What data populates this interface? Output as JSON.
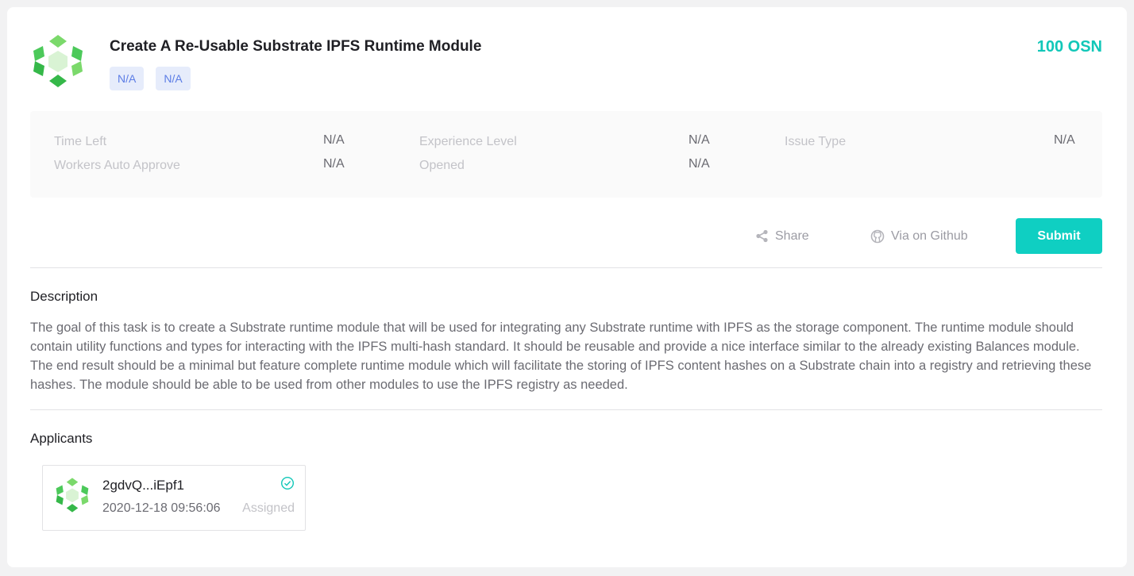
{
  "task": {
    "title": "Create A Re-Usable Substrate IPFS Runtime Module",
    "tags": [
      "N/A",
      "N/A"
    ],
    "reward": "100 OSN"
  },
  "info": {
    "time_left_label": "Time Left",
    "time_left_value": "N/A",
    "workers_auto_approve_label": "Workers Auto Approve",
    "workers_auto_approve_value": "N/A",
    "experience_level_label": "Experience Level",
    "experience_level_value": "N/A",
    "opened_label": "Opened",
    "opened_value": "N/A",
    "issue_type_label": "Issue Type",
    "issue_type_value": "N/A"
  },
  "actions": {
    "share_label": "Share",
    "github_label": "Via on Github",
    "submit_label": "Submit"
  },
  "description": {
    "heading": "Description",
    "text": "The goal of this task is to create a Substrate runtime module that will be used for integrating any Substrate runtime with IPFS as the storage component. The runtime module should contain utility functions and types for interacting with the IPFS multi-hash standard. It should be reusable and provide a nice interface similar to the already existing Balances module. The end result should be a minimal but feature complete runtime module which will facilitate the storing of IPFS content hashes on a Substrate chain into a registry and retrieving these hashes. The module should be able to be used from other modules to use the IPFS registry as needed."
  },
  "applicants": {
    "heading": "Applicants",
    "items": [
      {
        "name": "2gdvQ...iEpf1",
        "time": "2020-12-18 09:56:06",
        "status": "Assigned"
      }
    ]
  },
  "colors": {
    "accent": "#0fcfc2",
    "reward": "#11c7b8",
    "tag_bg": "#e6ecfb",
    "tag_text": "#5c7de6",
    "logo_green": "#4cc95a"
  },
  "icons": {
    "logo": "hexagon-logo-icon",
    "share": "share-icon",
    "github": "github-icon",
    "check": "check-circle-icon"
  }
}
